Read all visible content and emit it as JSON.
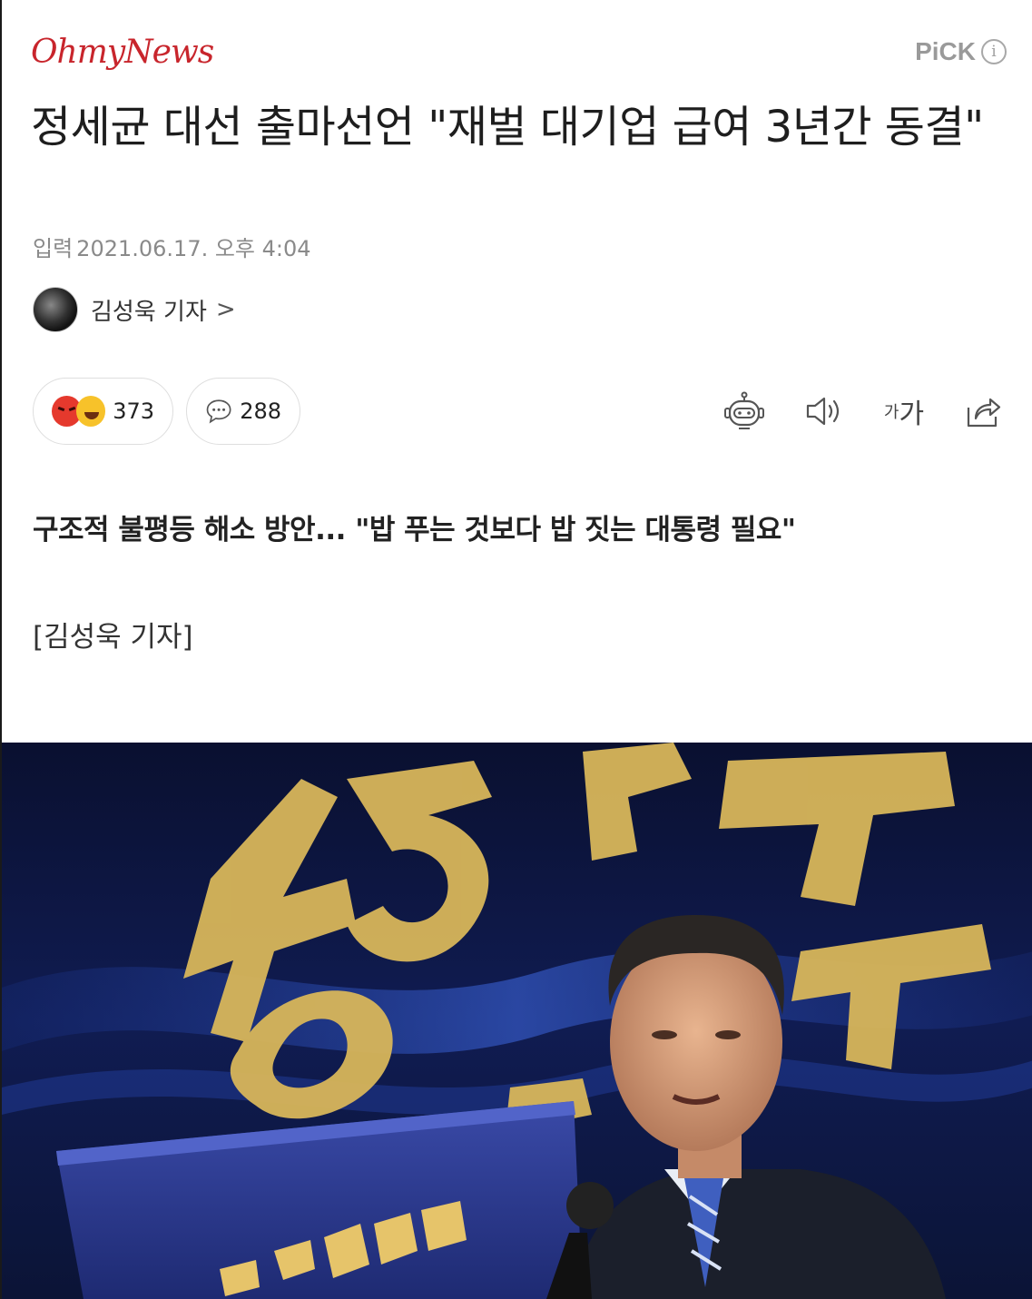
{
  "header": {
    "logo_text": "OhmyNews",
    "pick_label": "PiCK",
    "pick_info_label": "i"
  },
  "article": {
    "headline": "정세균 대선 출마선언 \"재벌 대기업 급여 3년간 동결\"",
    "date_label": "입력",
    "date_value": "2021.06.17. 오후 4:04",
    "author_name": "김성욱 기자",
    "author_chevron": ">",
    "subtitle": "구조적 불평등 해소 방안... \"밥 푸는 것보다 밥 짓는 대통령 필요\"",
    "byline": "[김성욱 기자]"
  },
  "actions": {
    "reaction_count": "373",
    "comment_count": "288",
    "font_size_label_small": "가",
    "font_size_label_large": "가"
  },
  "photo": {
    "banner_lines": [
      "강한",
      "대한민국"
    ],
    "podium_text": "대한민국"
  },
  "colors": {
    "brand_red": "#c8252c",
    "muted_gray": "#8a8a8a",
    "banner_gold": "#d8b65a"
  }
}
